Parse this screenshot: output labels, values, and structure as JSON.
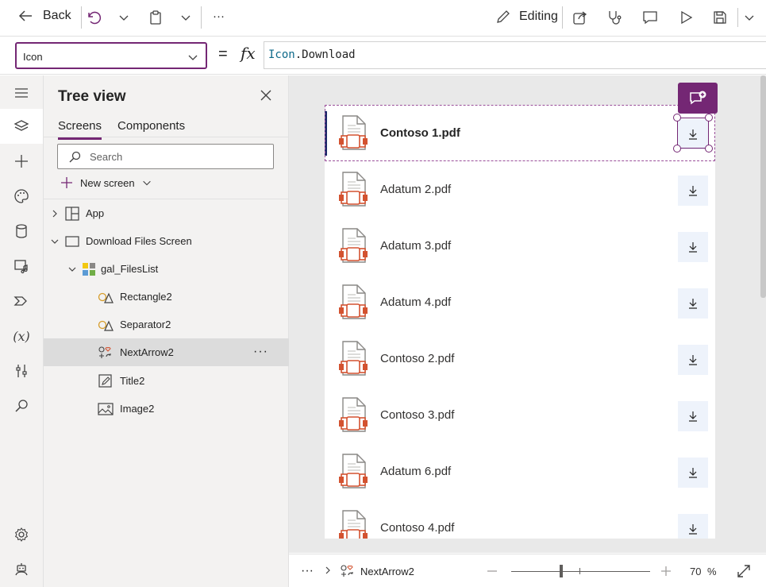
{
  "commandbar": {
    "back_label": "Back",
    "more_label": "···",
    "mode_label": "Editing"
  },
  "formula": {
    "property": "Icon",
    "eq": "=",
    "fx": "fx",
    "expr_object": "Icon",
    "expr_member": ".Download"
  },
  "tree": {
    "title": "Tree view",
    "tabs": [
      "Screens",
      "Components"
    ],
    "search_placeholder": "Search",
    "new_screen": "New screen",
    "nodes": [
      "App",
      "Download Files Screen",
      "gal_FilesList",
      "Rectangle2",
      "Separator2",
      "NextArrow2",
      "Title2",
      "Image2"
    ],
    "more": "···"
  },
  "gallery": {
    "files": [
      "Contoso 1.pdf",
      "Adatum 2.pdf",
      "Adatum 3.pdf",
      "Adatum 4.pdf",
      "Contoso 2.pdf",
      "Contoso 3.pdf",
      "Adatum 6.pdf",
      "Contoso 4.pdf"
    ]
  },
  "status": {
    "more": "···",
    "selected": "NextArrow2",
    "zoom": "70",
    "zoom_unit": "%"
  },
  "colors": {
    "accent": "#742774",
    "formula_keyword": "#0e6a8a",
    "doc_red": "#d35230"
  }
}
